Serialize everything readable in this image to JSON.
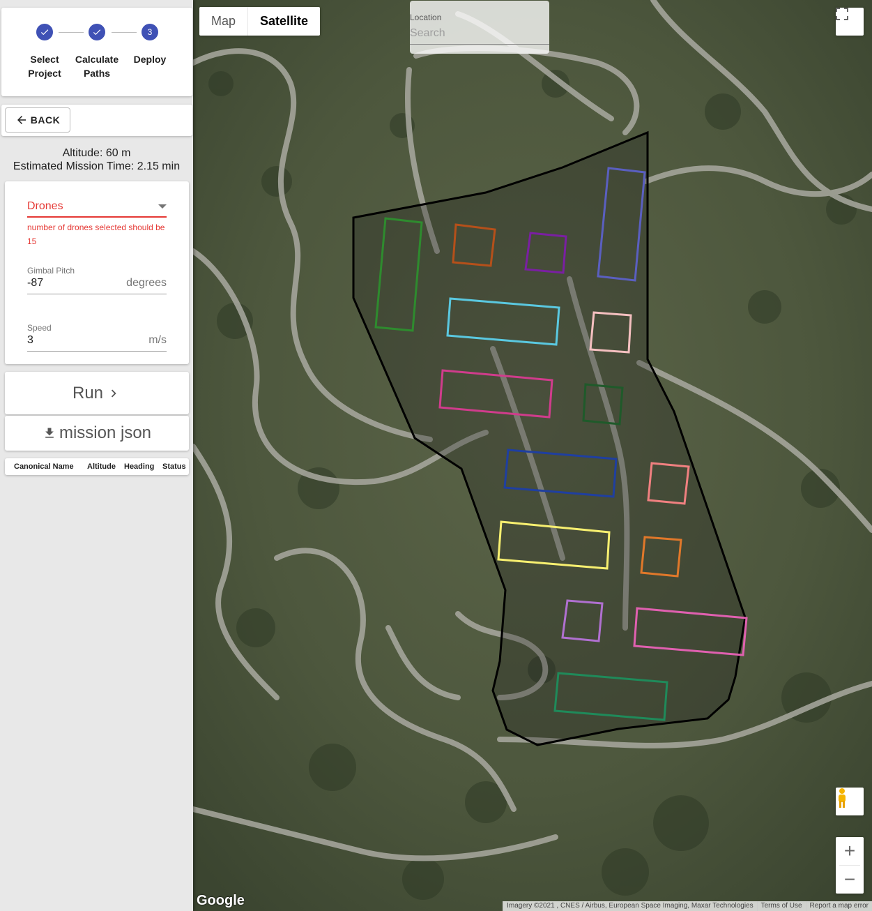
{
  "stepper": {
    "steps": [
      {
        "line1": "Select",
        "line2": "Project",
        "state": "done"
      },
      {
        "line1": "Calculate",
        "line2": "Paths",
        "state": "done"
      },
      {
        "line1": "Deploy",
        "line2": "",
        "state": "active",
        "number": "3"
      }
    ]
  },
  "back_label": "BACK",
  "info": {
    "altitude": "Altitude: 60 m",
    "mission_time": "Estimated Mission Time: 2.15 min"
  },
  "form": {
    "drones_label": "Drones",
    "drones_error": "number of drones selected should be 15",
    "gimbal_label": "Gimbal Pitch",
    "gimbal_value": "-87",
    "gimbal_unit": "degrees",
    "speed_label": "Speed",
    "speed_value": "3",
    "speed_unit": "m/s"
  },
  "actions": {
    "run_label": "Run",
    "mission_label": "mission json"
  },
  "table": {
    "columns": [
      "Canonical Name",
      "Altitude",
      "Heading",
      "Status"
    ]
  },
  "map": {
    "type_map": "Map",
    "type_satellite": "Satellite",
    "active_type": "Satellite",
    "location_label": "Location",
    "location_placeholder": "Search",
    "google_label": "Google",
    "attribution": "Imagery ©2021 , CNES / Airbus, European Space Imaging, Maxar Technologies",
    "terms": "Terms of Use",
    "report": "Report a map error",
    "zoom_in": "+",
    "zoom_out": "−"
  },
  "colors": {
    "primary": "#3f51b5",
    "error": "#e53935",
    "zone_colors": [
      "#2e8b2e",
      "#b5501a",
      "#7a1fa2",
      "#5a5fc0",
      "#5ac8e0",
      "#f5c0c0",
      "#d03c8c",
      "#1f5a2a",
      "#1f3fa0",
      "#f08080",
      "#f8f070",
      "#e0782a",
      "#b070d0",
      "#e060b0",
      "#1f8a5a"
    ]
  }
}
